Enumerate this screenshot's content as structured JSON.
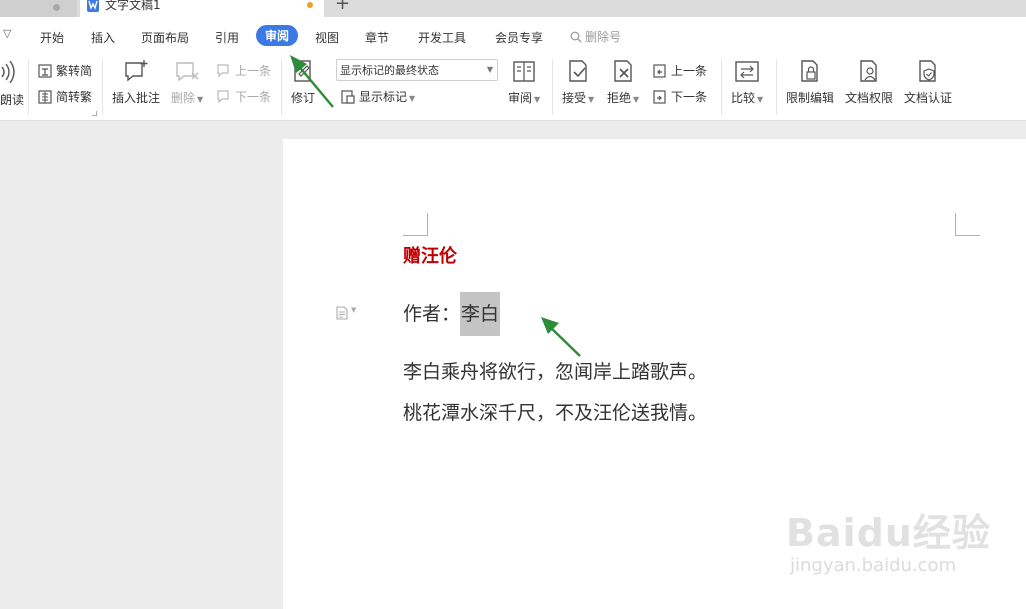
{
  "tabs": {
    "active_title": "文字文稿1",
    "add_glyph": "+"
  },
  "menu": {
    "dropdown_glyph": "▽",
    "items": [
      "开始",
      "插入",
      "页面布局",
      "引用",
      "审阅",
      "视图",
      "章节",
      "开发工具",
      "会员专享"
    ],
    "active": "审阅",
    "search_label": "删除号"
  },
  "ribbon": {
    "partial_label": "朗读",
    "trad_to_simp": "繁转简",
    "simp_to_trad": "简转繁",
    "insert_comment": "插入批注",
    "delete": "删除",
    "prev_comment": "上一条",
    "next_comment": "下一条",
    "track_changes": "修订",
    "markup_state": "显示标记的最终状态",
    "show_markup": "显示标记",
    "review": "审阅",
    "accept": "接受",
    "reject": "拒绝",
    "prev_change": "上一条",
    "next_change": "下一条",
    "compare": "比较",
    "restrict_edit": "限制编辑",
    "doc_permission": "文档权限",
    "doc_certify": "文档认证"
  },
  "document": {
    "title": "赠汪伦",
    "author_label": "作者：",
    "author_name": "李白",
    "lines": [
      "李白乘舟将欲行，忽闻岸上踏歌声。",
      "桃花潭水深千尺，不及汪伦送我情。"
    ]
  },
  "watermark": {
    "brand": "Baidu经验",
    "url": "jingyan.baidu.com"
  },
  "colors": {
    "accent": "#3b7ae4",
    "title_red": "#c00000",
    "arrow_green": "#2e8b3a",
    "selection_gray": "#c4c4c4"
  }
}
